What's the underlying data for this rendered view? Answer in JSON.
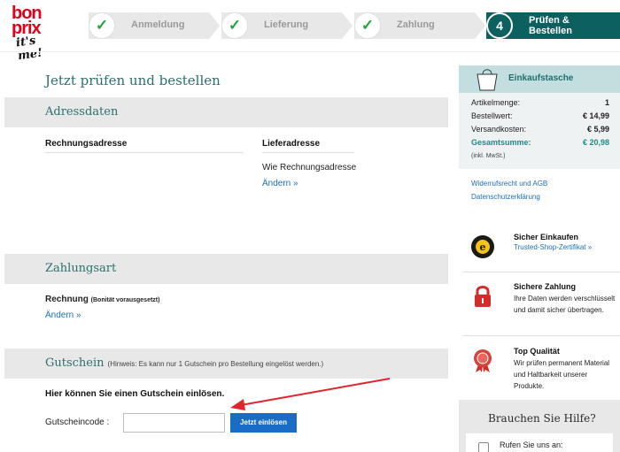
{
  "logo": {
    "line1": "bon",
    "line2": "prix",
    "tagline": "it's me!"
  },
  "steps": [
    {
      "label": "Anmeldung",
      "state": "done",
      "icon": "checkmark-icon"
    },
    {
      "label": "Lieferung",
      "state": "done",
      "icon": "checkmark-icon"
    },
    {
      "label": "Zahlung",
      "state": "done",
      "icon": "checkmark-icon"
    },
    {
      "number": "4",
      "label_line1": "Prüfen &",
      "label_line2": "Bestellen",
      "state": "active"
    }
  ],
  "main": {
    "title": "Jetzt prüfen und bestellen",
    "address": {
      "section_title": "Adressdaten",
      "billing_heading": "Rechnungsadresse",
      "delivery_heading": "Lieferadresse",
      "delivery_value": "Wie Rechnungsadresse",
      "change_link": "Ändern »"
    },
    "payment": {
      "section_title": "Zahlungsart",
      "method": "Rechnung",
      "method_note": "(Bonität vorausgesetzt)",
      "change_link": "Ändern »"
    },
    "coupon": {
      "section_title": "Gutschein",
      "hint": "(Hinweis: Es kann nur 1 Gutschein pro Bestellung eingelöst werden.)",
      "intro": "Hier können Sie einen Gutschein einlösen.",
      "field_label": "Gutscheincode :",
      "field_value": "",
      "button_label": "Jetzt einlösen"
    }
  },
  "cart": {
    "title": "Einkaufstasche",
    "rows": [
      {
        "label": "Artikelmenge:",
        "value": "1"
      },
      {
        "label": "Bestellwert:",
        "value": "€ 14,99"
      },
      {
        "label": "Versandkosten:",
        "value": "€ 5,99"
      }
    ],
    "total_label": "Gesamtsumme:",
    "total_value": "€ 20,98",
    "vat_note": "(inkl. MwSt.)"
  },
  "side_links": [
    "Widerrufsrecht und AGB",
    "Datenschutzerklärung"
  ],
  "features": [
    {
      "icon": "trusted-shops-seal-icon",
      "title": "Sicher Einkaufen",
      "link": "Trusted-Shop-Zertifikat »"
    },
    {
      "icon": "padlock-icon",
      "title": "Sichere Zahlung",
      "text": "Ihre Daten werden verschlüsselt und damit sicher übertragen."
    },
    {
      "icon": "quality-seal-icon",
      "title": "Top Qualität",
      "text": "Wir prüfen permanent Material und Haltbarkeit unserer Produkte."
    }
  ],
  "help": {
    "title": "Brauchen Sie Hilfe?",
    "text": "Rufen Sie uns an:"
  },
  "colors": {
    "accent": "#0d6060",
    "brand_red": "#e2001a",
    "link": "#1c6fb8",
    "button": "#1a6dc4",
    "check": "#23a33c"
  }
}
